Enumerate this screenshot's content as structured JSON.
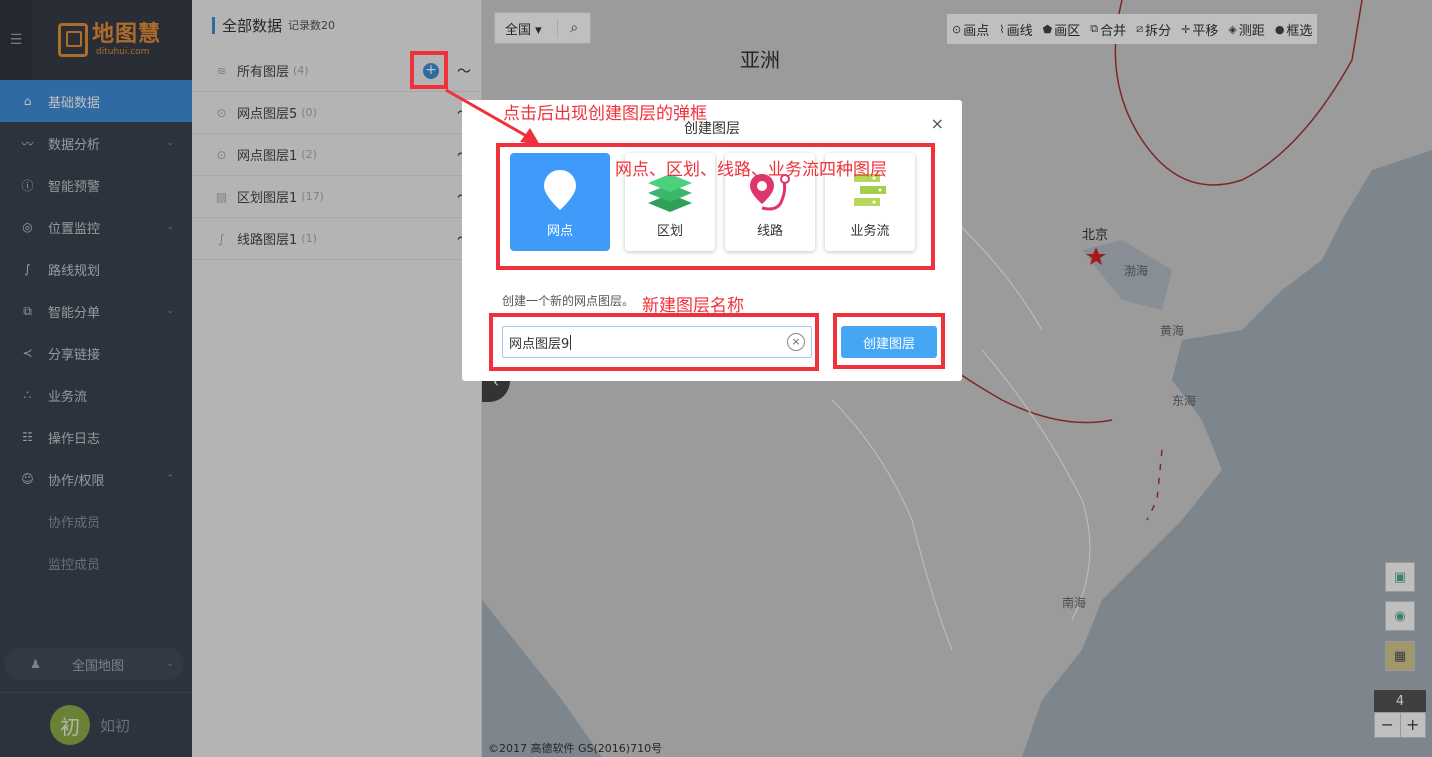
{
  "logo": {
    "cn": "地图慧",
    "en": "dituhui.com"
  },
  "sidebar": {
    "items": [
      {
        "label": "基础数据",
        "icon": "home-icon",
        "active": true
      },
      {
        "label": "数据分析",
        "icon": "chart-icon",
        "arrow": "down"
      },
      {
        "label": "智能预警",
        "icon": "alert-icon"
      },
      {
        "label": "位置监控",
        "icon": "location-icon",
        "arrow": "down"
      },
      {
        "label": "路线规划",
        "icon": "route-icon"
      },
      {
        "label": "智能分单",
        "icon": "split-icon",
        "arrow": "down"
      },
      {
        "label": "分享链接",
        "icon": "share-icon"
      },
      {
        "label": "业务流",
        "icon": "workflow-icon"
      },
      {
        "label": "操作日志",
        "icon": "log-icon"
      },
      {
        "label": "协作/权限",
        "icon": "users-icon",
        "arrow": "up"
      }
    ],
    "subitems": [
      "协作成员",
      "监控成员"
    ],
    "region": "全国地图",
    "user": {
      "avatar": "初",
      "name": "如初"
    }
  },
  "panel": {
    "title": "全部数据",
    "count": "记录数20",
    "layers": [
      {
        "name": "所有图层",
        "count": "(4)",
        "icon": "layers-icon"
      },
      {
        "name": "网点图层5",
        "count": "(0)",
        "icon": "pin-icon"
      },
      {
        "name": "网点图层1",
        "count": "(2)",
        "icon": "pin-icon"
      },
      {
        "name": "区划图层1",
        "count": "(17)",
        "icon": "region-icon"
      },
      {
        "name": "线路图层1",
        "count": "(1)",
        "icon": "route-icon"
      }
    ]
  },
  "map": {
    "scope": "全国",
    "tools": [
      "画点",
      "画线",
      "画区",
      "合并",
      "拆分",
      "平移",
      "测距",
      "框选"
    ],
    "labels": {
      "continent": "亚洲",
      "beijing": "北京",
      "bohai": "渤海",
      "huanghai": "黄海",
      "donghai": "东海",
      "nanhai": "南海"
    },
    "zoom": "4",
    "copyright": "©2017 高德软件 GS(2016)710号"
  },
  "modal": {
    "title": "创建图层",
    "types": [
      {
        "label": "网点",
        "selected": true
      },
      {
        "label": "区划"
      },
      {
        "label": "线路"
      },
      {
        "label": "业务流"
      }
    ],
    "description": "创建一个新的网点图层。",
    "input_value": "网点图层9",
    "create_label": "创建图层"
  },
  "annotations": {
    "popup": "点击后出现创建图层的弹框",
    "types": "网点、区划、线路、业务流四种图层",
    "name": "新建图层名称"
  },
  "colors": {
    "accent": "#3f8fd9",
    "annotation": "#f0303a",
    "logo": "#e8913a",
    "sidebar": "#3d4452"
  }
}
